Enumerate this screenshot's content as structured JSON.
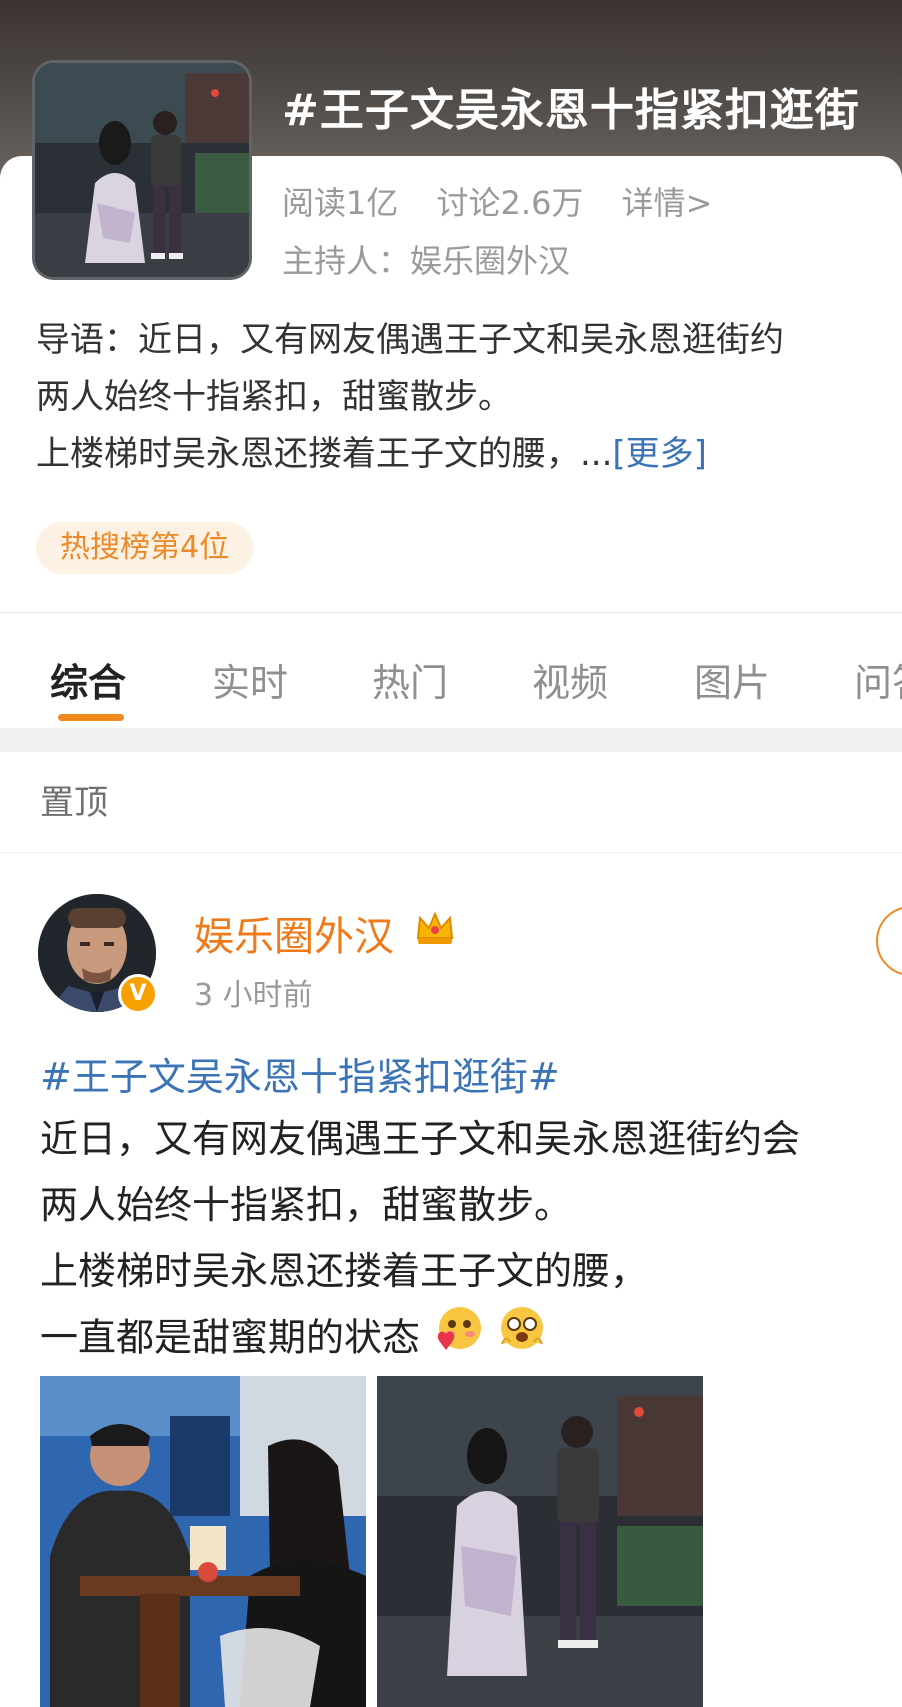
{
  "topic": {
    "title": "#王子文吴永恩十指紧扣逛街",
    "reads": "阅读1亿",
    "discussions": "讨论2.6万",
    "details": "详情>",
    "host": "主持人：娱乐圈外汉",
    "intro_lines": [
      "导语：近日，又有网友偶遇王子文和吴永恩逛街约",
      "两人始终十指紧扣，甜蜜散步。",
      "上楼梯时吴永恩还搂着王子文的腰，..."
    ],
    "more": "[更多]",
    "hot_badge": "热搜榜第4位"
  },
  "tabs": [
    "综合",
    "实时",
    "热门",
    "视频",
    "图片",
    "问答"
  ],
  "pinned_label": "置顶",
  "post": {
    "username": "娱乐圈外汉",
    "time": "3 小时前",
    "verified_mark": "V",
    "hashtag": "#王子文吴永恩十指紧扣逛街#",
    "lines": [
      "近日，又有网友偶遇王子文和吴永恩逛街约会",
      "两人始终十指紧扣，甜蜜散步。",
      "上楼梯时吴永恩还搂着王子文的腰，",
      "一直都是甜蜜期的状态"
    ]
  },
  "icons": {
    "crown": "crown-icon",
    "emoji1": "blush-heart-emoji-icon",
    "emoji2": "star-eyes-emoji-icon"
  },
  "colors": {
    "accent_orange": "#f08a1d",
    "link_blue": "#3b74b6",
    "username_orange": "#ef7a19"
  }
}
